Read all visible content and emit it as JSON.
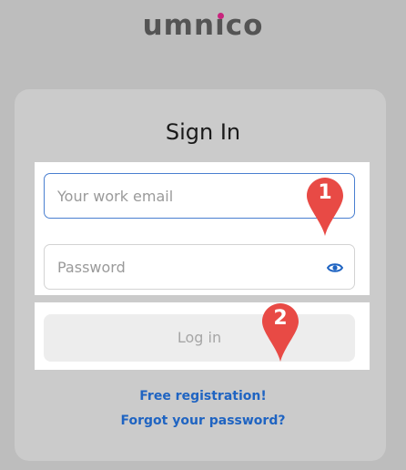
{
  "brand": {
    "logo_prefix": "umn",
    "logo_i": "ı",
    "logo_suffix": "co",
    "logo_color": "#545454",
    "logo_dot_color": "#c8247d"
  },
  "form": {
    "title": "Sign In",
    "email": {
      "placeholder": "Your work email",
      "value": ""
    },
    "password": {
      "placeholder": "Password",
      "value": "",
      "toggle_icon": "eye-icon"
    },
    "login_label": "Log in",
    "login_enabled": false
  },
  "links": {
    "register": "Free registration!",
    "forgot": "Forgot your password?"
  },
  "annotations": {
    "marker_1": "1",
    "marker_2": "2",
    "marker_color": "#e84a45"
  },
  "colors": {
    "accent": "#1f64c2",
    "input_focus_border": "#4a7fd0",
    "background": "#bdbdbd",
    "card": "#cbcbcb"
  }
}
